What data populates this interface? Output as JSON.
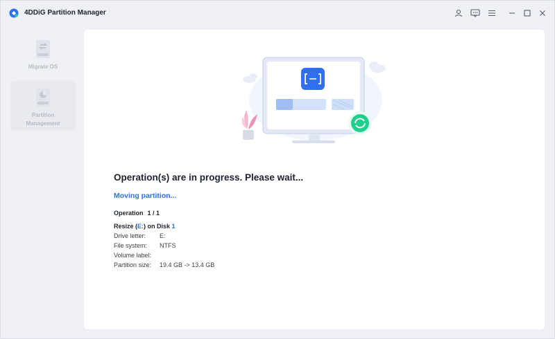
{
  "app": {
    "title": "4DDiG Partition Manager"
  },
  "titlebar": {
    "icons": [
      "user-icon",
      "feedback-icon",
      "menu-icon",
      "minimize-icon",
      "maximize-icon",
      "close-icon"
    ]
  },
  "sidebar": {
    "items": [
      {
        "label": "Migrate OS",
        "icon": "migrate-os-icon",
        "active": false
      },
      {
        "label": "Partition Management",
        "icon": "partition-management-icon",
        "active": true
      }
    ]
  },
  "main": {
    "heading": "Operation(s) are in progress. Please wait...",
    "status": "Moving partition...",
    "operation": {
      "label": "Operation",
      "value": "1 / 1"
    },
    "resize": {
      "prefix": "Resize (",
      "drive": "E:",
      "middle": ") on Disk ",
      "disk": "1"
    },
    "details": [
      {
        "key": "Drive letter:",
        "value": "E:"
      },
      {
        "key": "File system:",
        "value": "NTFS"
      },
      {
        "key": "Volume label:",
        "value": ""
      },
      {
        "key": "Partition size:",
        "value": "19.4 GB -> 13.4 GB"
      }
    ]
  },
  "colors": {
    "accent": "#2f6ff0",
    "success": "#1fcf8f",
    "text": "#1d2130"
  }
}
